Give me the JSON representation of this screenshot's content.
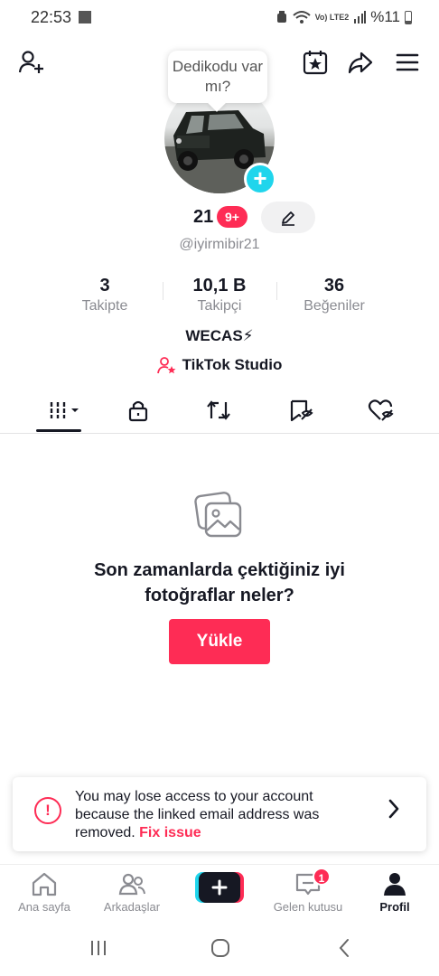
{
  "status_bar": {
    "time": "22:53",
    "network": "Vo) LTE2",
    "battery": "%11"
  },
  "tooltip": {
    "text": "Dedikodu var mı?"
  },
  "profile": {
    "display_name": "21",
    "notification_badge": "9+",
    "username": "@iyirmibir21",
    "bio": "WECAS⚡",
    "studio_link": "TikTok Studio"
  },
  "stats": [
    {
      "value": "3",
      "label": "Takipte"
    },
    {
      "value": "10,1 B",
      "label": "Takipçi"
    },
    {
      "value": "36",
      "label": "Beğeniler"
    }
  ],
  "tabs": [
    {
      "icon": "grid-icon",
      "active": true
    },
    {
      "icon": "lock-icon",
      "active": false
    },
    {
      "icon": "repost-icon",
      "active": false
    },
    {
      "icon": "saved-icon",
      "active": false
    },
    {
      "icon": "liked-icon",
      "active": false
    }
  ],
  "empty_state": {
    "message": "Son zamanlarda çektiğiniz iyi fotoğraflar neler?",
    "button": "Yükle"
  },
  "banner": {
    "message": "You may lose access to your account because the linked email address was removed.",
    "action": "Fix issue"
  },
  "bottom_nav": [
    {
      "label": "Ana sayfa",
      "icon": "home-icon"
    },
    {
      "label": "Arkadaşlar",
      "icon": "friends-icon"
    },
    {
      "label": "",
      "icon": "create-icon"
    },
    {
      "label": "Gelen kutusu",
      "icon": "inbox-icon",
      "badge": "1"
    },
    {
      "label": "Profil",
      "icon": "profile-icon",
      "active": true
    }
  ],
  "colors": {
    "accent": "#fe2c55",
    "cyan": "#20d5ec",
    "text": "#161823",
    "muted": "#8a8b91"
  }
}
